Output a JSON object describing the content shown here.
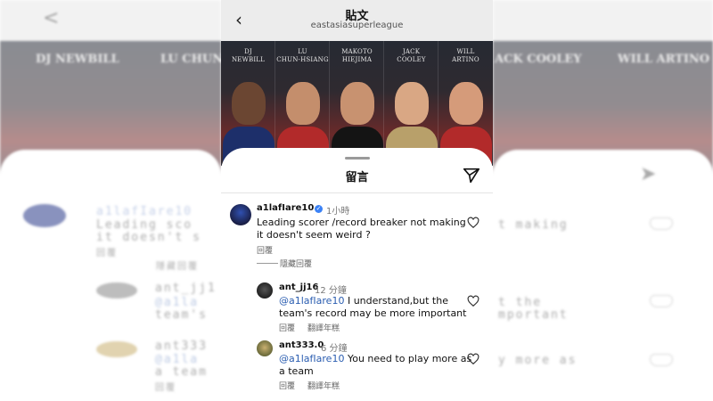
{
  "header": {
    "back_icon": "chevron-left-icon",
    "title": "貼文",
    "account": "eastasiasuperleague"
  },
  "poster": {
    "players": [
      {
        "first": "DJ",
        "last": "NEWBILL",
        "jersey_color": "#1d2f6a"
      },
      {
        "first": "LU",
        "last": "CHUN-HSIANG",
        "jersey_color": "#b22a2a"
      },
      {
        "first": "MAKOTO",
        "last": "HIEJIMA",
        "jersey_color": "#141414"
      },
      {
        "first": "JACK",
        "last": "COOLEY",
        "jersey_color": "#b8a06a"
      },
      {
        "first": "WILL",
        "last": "ARTINO",
        "jersey_color": "#b22a2a"
      }
    ]
  },
  "sheet": {
    "title": "留言",
    "send_icon": "paper-plane-icon"
  },
  "comments": [
    {
      "username": "a1lafIare10",
      "verified": true,
      "time": "1小時",
      "text_line1": "Leading scorer /record breaker not making",
      "text_line2": "it doesn't seem weird ?",
      "reply": "回覆",
      "hide_replies": "隱藏回覆"
    },
    {
      "username": "ant_jj16",
      "time": "12 分鐘",
      "mention": "@a1lafIare10",
      "text_line1": " I understand,but the",
      "text_line2": "team's record may be more important",
      "reply": "回覆",
      "translate": "翻譯年糕"
    },
    {
      "username": "ant333.0",
      "time": "6 分鐘",
      "mention": "@a1lafIare10",
      "text_line1": " You need to play more as",
      "text_line2": "a team",
      "reply": "回覆",
      "translate": "翻譯年糕"
    }
  ],
  "background_blur": {
    "left_names": [
      "DJ NEWBILL",
      "LU CHUN-H"
    ],
    "left_lines": [
      "a1lafIare10",
      "Leading sco",
      "it doesn't s",
      "回覆",
      "隱藏回覆",
      "ant_jj1",
      "@a1la",
      "team's",
      "ant333",
      "@a1la",
      "a team",
      "回覆"
    ],
    "right_names": [
      "ACK COOLEY",
      "WILL ARTINO"
    ],
    "right_lines": [
      "t making",
      "t the",
      "mportant",
      "y more as"
    ]
  }
}
